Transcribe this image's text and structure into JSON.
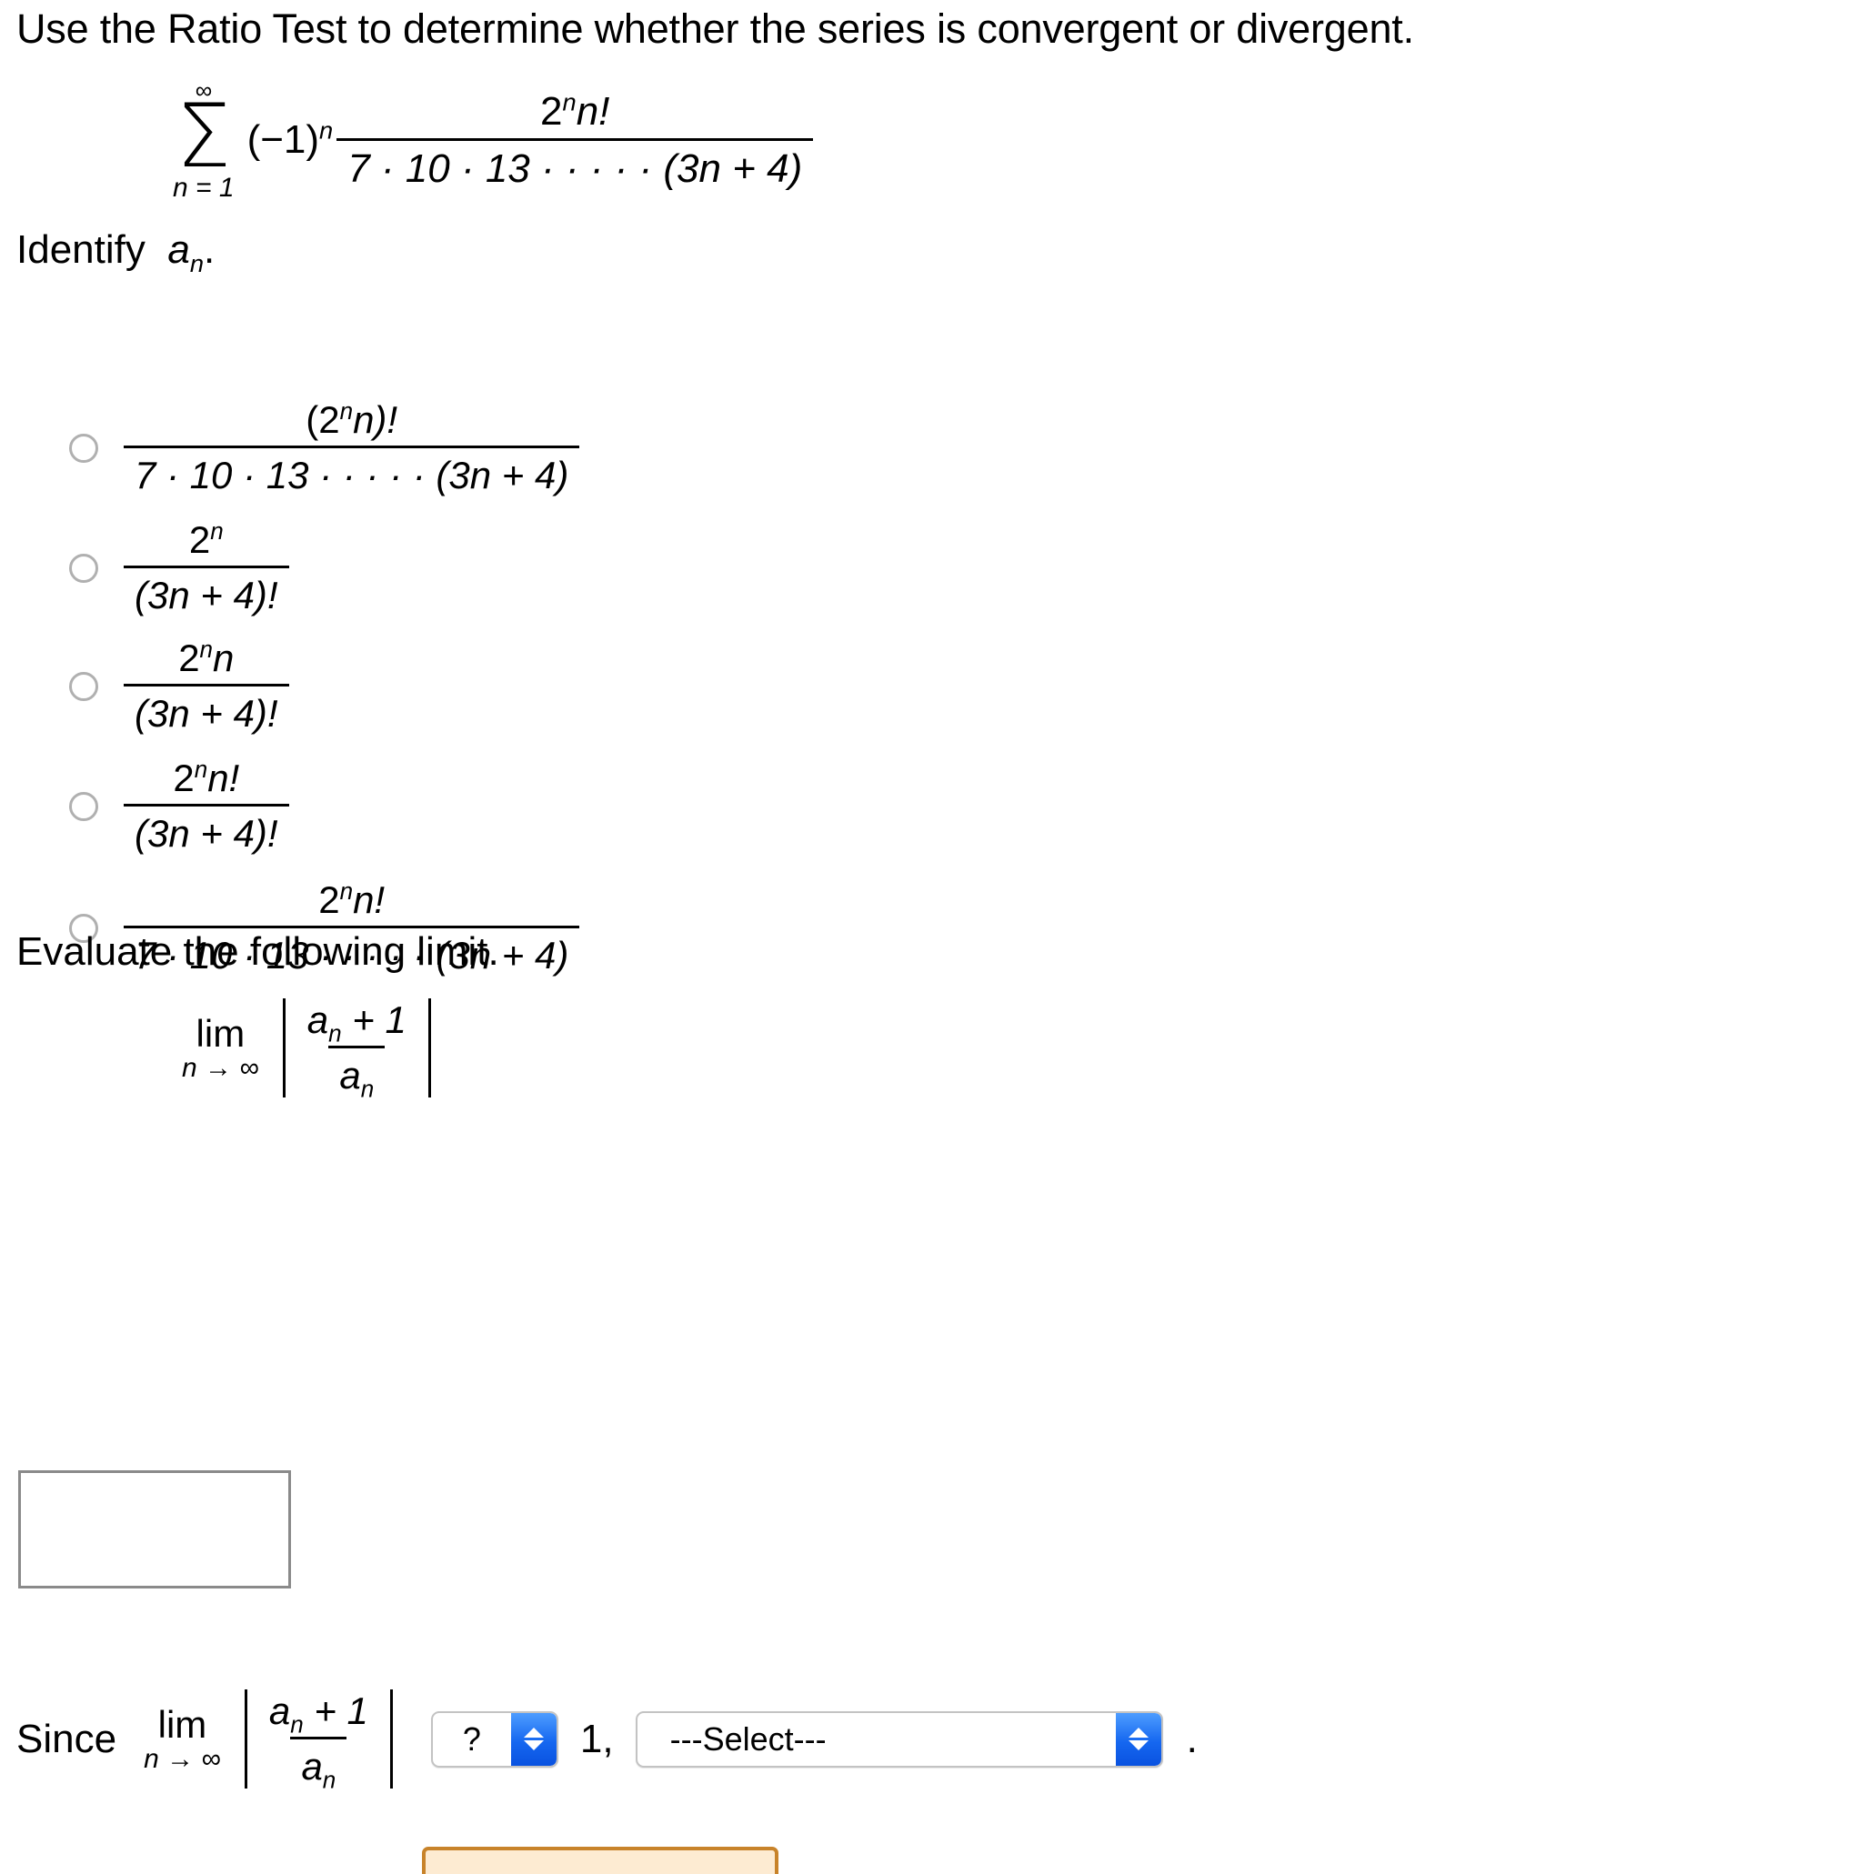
{
  "prompt": "Use the Ratio Test to determine whether the series is convergent or divergent.",
  "series": {
    "sigma_upper": "∞",
    "sigma_glyph": "Σ",
    "sigma_lower": "n = 1",
    "coefficient": "(−1)",
    "coefficient_exponent": "n",
    "numerator_base": "2",
    "numerator_exponent": "n",
    "numerator_tail": "n!",
    "denominator": "7 · 10 · 13 · · · · · (3n + 4)"
  },
  "identify": {
    "label": "Identify",
    "symbol_base": "a",
    "symbol_sub": "n",
    "period": "."
  },
  "options": [
    {
      "id": "option-1",
      "numerator": "(2ⁿn)!",
      "num_base": "(2",
      "num_exp": "n",
      "num_tail": "n)!",
      "denominator": "7 · 10 · 13 · · · · · (3n + 4)",
      "selected": false
    },
    {
      "id": "option-2",
      "num_base": "2",
      "num_exp": "n",
      "num_tail": "",
      "denominator": "(3n + 4)!",
      "selected": false
    },
    {
      "id": "option-3",
      "num_base": "2",
      "num_exp": "n",
      "num_tail": "n",
      "denominator": "(3n + 4)!",
      "selected": false
    },
    {
      "id": "option-4",
      "num_base": "2",
      "num_exp": "n",
      "num_tail": "n!",
      "denominator": "(3n + 4)!",
      "selected": false
    },
    {
      "id": "option-5",
      "num_base": "2",
      "num_exp": "n",
      "num_tail": "n!",
      "denominator": "7 · 10 · 13 · · · · · (3n + 4)",
      "selected": false
    }
  ],
  "evaluate": {
    "label": "Evaluate the following limit.",
    "lim_word": "lim",
    "lim_sub": "n → ∞",
    "ratio_num_base": "a",
    "ratio_num_sub": "n",
    "ratio_num_tail": " + 1",
    "ratio_den_base": "a",
    "ratio_den_sub": "n"
  },
  "answer_input": {
    "value": "",
    "placeholder": ""
  },
  "since_row": {
    "since_word": "Since",
    "lim_word": "lim",
    "lim_sub": "n → ∞",
    "ratio_num_base": "a",
    "ratio_num_sub": "n",
    "ratio_num_tail": " + 1",
    "ratio_den_base": "a",
    "ratio_den_sub": "n",
    "comparison_value": "?",
    "one_comma": "1,",
    "conclusion_value": "---Select---",
    "trailing_period": "."
  },
  "colors": {
    "radio_border": "#b0b0b0",
    "input_border": "#8a8a8a",
    "select_border": "#c3c3c3",
    "stepper_blue": "#1567f0",
    "bottom_button_border": "#c8832a",
    "bottom_button_fill": "#fdebd2",
    "text": "#000000",
    "background": "#ffffff"
  }
}
